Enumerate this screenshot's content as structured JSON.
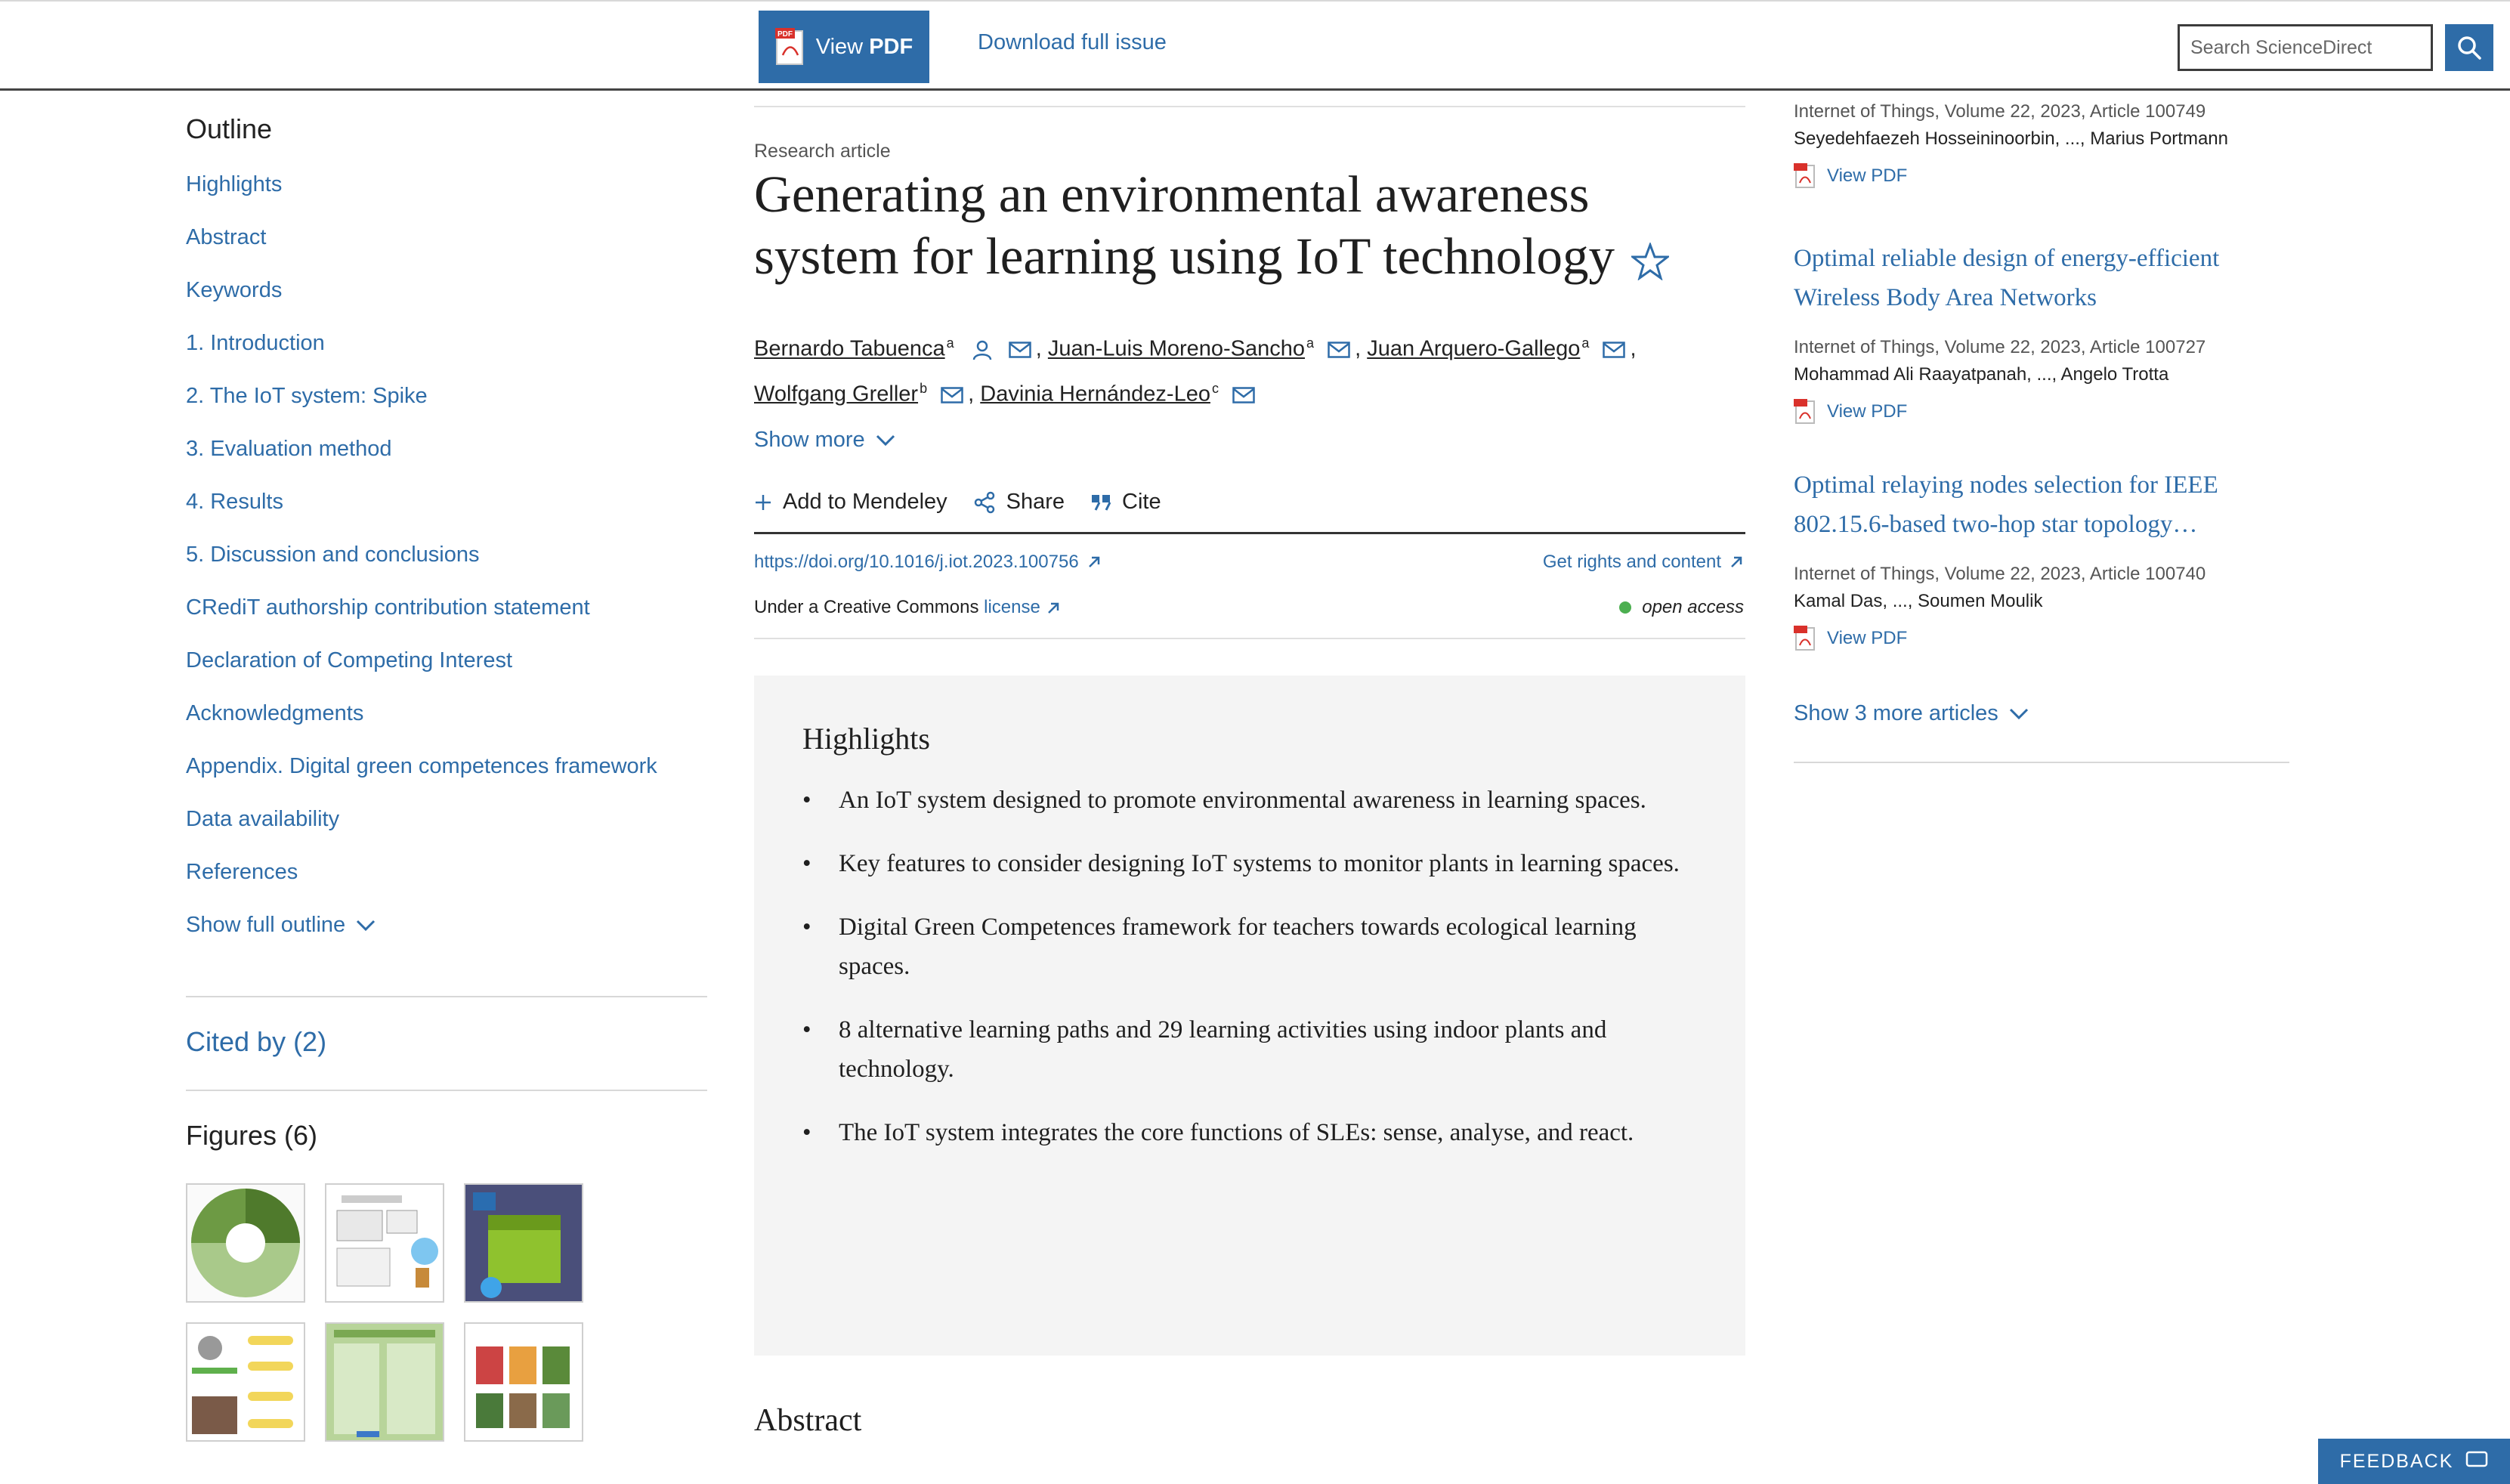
{
  "topbar": {
    "view_pdf_prefix": "View",
    "view_pdf_bold": "PDF",
    "download_full_issue": "Download full issue",
    "search_placeholder": "Search ScienceDirect"
  },
  "outline": {
    "title": "Outline",
    "items": [
      "Highlights",
      "Abstract",
      "Keywords",
      "1. Introduction",
      "2. The IoT system: Spike",
      "3. Evaluation method",
      "4. Results",
      "5. Discussion and conclusions",
      "CRediT authorship contribution statement",
      "Declaration of Competing Interest",
      "Acknowledgments",
      "Appendix. Digital green competences framework",
      "Data availability",
      "References"
    ],
    "show_full_outline": "Show full outline",
    "cited_by": "Cited by (2)",
    "figures_title": "Figures (6)"
  },
  "article": {
    "type": "Research article",
    "title": "Generating an environmental awareness system for learning using IoT technology",
    "authors": [
      {
        "name": "Bernardo Tabuenca",
        "aff": "a"
      },
      {
        "name": "Juan-Luis Moreno-Sancho",
        "aff": "a"
      },
      {
        "name": "Juan Arquero-Gallego",
        "aff": "a"
      },
      {
        "name": "Wolfgang Greller",
        "aff": "b"
      },
      {
        "name": "Davinia Hernández-Leo",
        "aff": "c"
      }
    ],
    "show_more": "Show more",
    "add_mendeley": "Add to Mendeley",
    "share": "Share",
    "cite": "Cite",
    "doi": "https://doi.org/10.1016/j.iot.2023.100756",
    "rights": "Get rights and content",
    "license_prefix": "Under a Creative Commons",
    "license_link": "license",
    "open_access": "open access",
    "highlights_title": "Highlights",
    "highlights": [
      "An IoT system designed to promote environmental awareness in learning spaces.",
      "Key features to consider designing IoT systems to monitor plants in learning spaces.",
      "Digital Green Competences framework for teachers towards ecological learning spaces.",
      "8 alternative learning paths and 29 learning activities using indoor plants and technology.",
      "The IoT system integrates the core functions of SLEs: sense, analyse, and react."
    ],
    "abstract_title": "Abstract"
  },
  "recommended": {
    "items": [
      {
        "title": "",
        "meta": "Internet of Things, Volume 22, 2023, Article 100749",
        "authors": "Seyedehfaezeh Hosseininoorbin, ..., Marius Portmann",
        "pdf": "View PDF"
      },
      {
        "title": "Optimal reliable design of energy-efficient Wireless Body Area Networks",
        "meta": "Internet of Things, Volume 22, 2023, Article 100727",
        "authors": "Mohammad Ali Raayatpanah, ..., Angelo Trotta",
        "pdf": "View PDF"
      },
      {
        "title": "Optimal relaying nodes selection for IEEE 802.15.6-based two-hop star topology…",
        "meta": "Internet of Things, Volume 22, 2023, Article 100740",
        "authors": "Kamal Das, ..., Soumen Moulik",
        "pdf": "View PDF"
      }
    ],
    "show_more_articles": "Show 3 more articles"
  },
  "feedback": "FEEDBACK",
  "colors": {
    "link": "#2e6ca8",
    "highlights_bg": "#f4f4f4",
    "open_access_dot": "#4caf50"
  }
}
